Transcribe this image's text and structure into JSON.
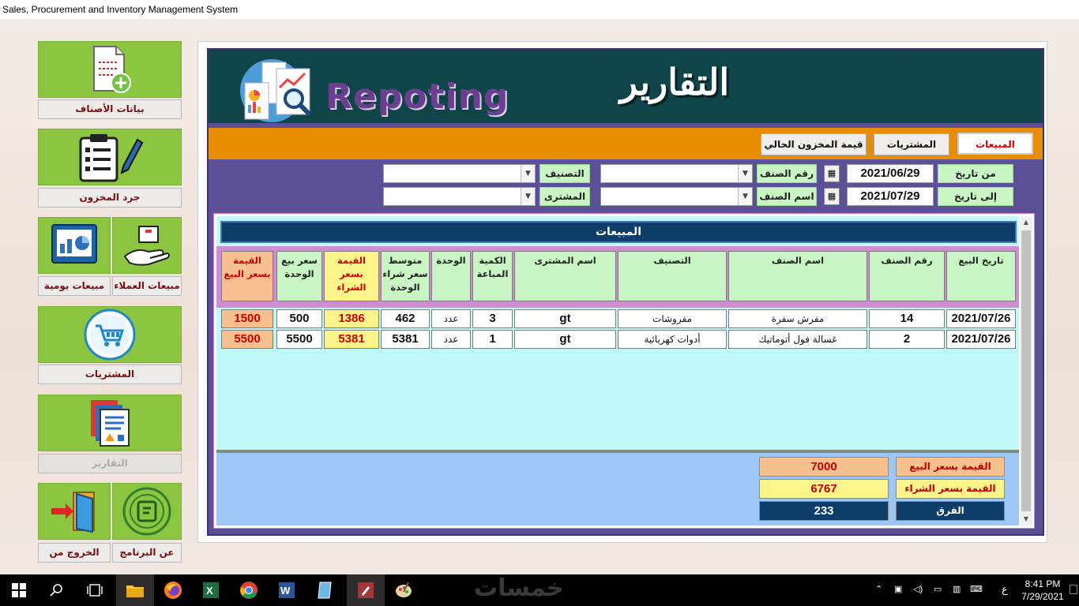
{
  "window": {
    "title": "Sales, Procurement and Inventory Management System"
  },
  "sidebar": {
    "items": [
      {
        "label": "بيانات الأصناف"
      },
      {
        "label": "جرد المخزون"
      },
      {
        "label": "مبيعات العملاء"
      },
      {
        "label": "مبيعات يومية"
      },
      {
        "label": "المشتريات"
      },
      {
        "label": "التقارير"
      },
      {
        "label": "عن البرنامج"
      },
      {
        "label": "الخروج من"
      }
    ]
  },
  "header": {
    "logo_text": "Repoting",
    "arabic_title": "التقارير"
  },
  "tabs": [
    {
      "label": "المبيعات",
      "active": true
    },
    {
      "label": "المشتريات",
      "active": false
    },
    {
      "label": "قيمة المخزون الحالي",
      "active": false
    }
  ],
  "filters": {
    "from_date_label": "من تاريخ",
    "from_date": "2021/06/29",
    "to_date_label": "إلى تاريخ",
    "to_date": "2021/07/29",
    "item_no_label": "رقم الصنف",
    "item_name_label": "اسم الصنف",
    "category_label": "التصنيف",
    "buyer_label": "المشترى",
    "item_no_value": "",
    "item_name_value": "",
    "category_value": "",
    "buyer_value": ""
  },
  "table": {
    "title": "المبيعات",
    "columns": [
      "تاريخ البيع",
      "رقم الصنف",
      "اسم الصنف",
      "التصنيف",
      "اسم المشترى",
      "الكمية المباعة",
      "الوحدة",
      "متوسط سعر شراء الوحدة",
      "القيمة بسعر الشراء",
      "سعر بيع الوحدة",
      "القيمة بسعر البيع"
    ],
    "rows": [
      [
        "2021/07/26",
        "14",
        "مفرش سفرة",
        "مفروشات",
        "gt",
        "3",
        "عدد",
        "462",
        "1386",
        "500",
        "1500"
      ],
      [
        "2021/07/26",
        "2",
        "غسالة فول أتوماتيك",
        "أدوات كهربائية",
        "gt",
        "1",
        "عدد",
        "5381",
        "5381",
        "5500",
        "5500"
      ]
    ]
  },
  "totals": {
    "sale_value_label": "القيمة بسعر البيع",
    "sale_value": "7000",
    "purchase_value_label": "القيمة بسعر الشراء",
    "purchase_value": "6767",
    "difference_label": "الفرق",
    "difference": "233"
  },
  "taskbar": {
    "watermark": "خمسات",
    "lang": "ع",
    "time": "8:41 PM",
    "date": "7/29/2021"
  },
  "colors": {
    "tile_green": "#8cc540",
    "header_teal": "#0f4548",
    "orange_bar": "#e88d00",
    "panel_purple": "#5b4f97",
    "table_cyan": "#bff9f7",
    "totals_blue": "#9cc7f7",
    "accent_red": "#d10000"
  }
}
